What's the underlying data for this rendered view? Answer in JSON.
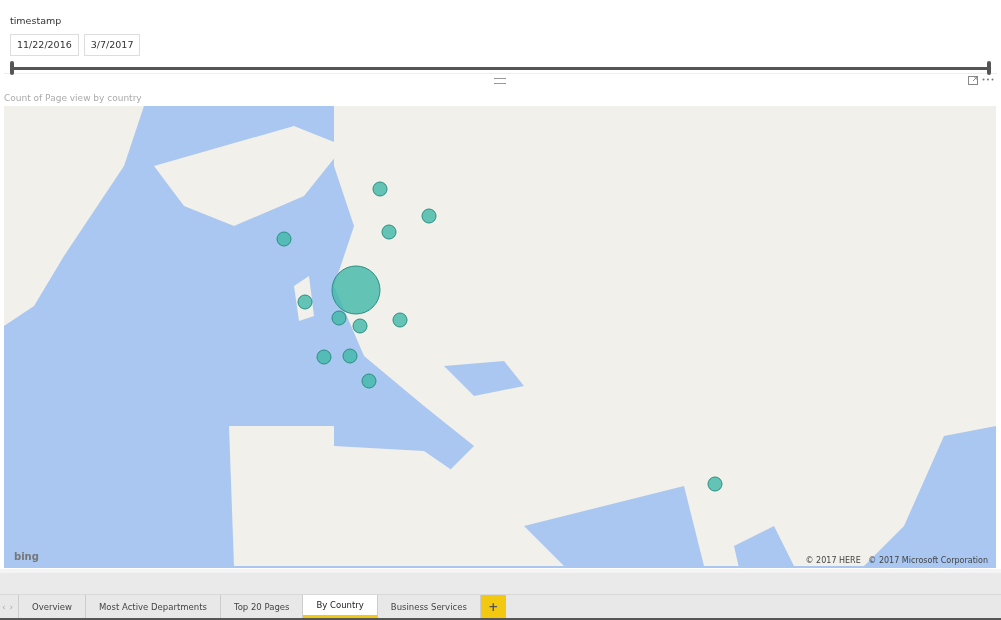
{
  "slicer": {
    "title": "timestamp",
    "start_date": "11/22/2016",
    "end_date": "3/7/2017",
    "handles": [
      {
        "level": 0
      },
      {
        "level": 1
      }
    ]
  },
  "visual": {
    "title": "Count of Page view by country",
    "logo": "bing",
    "attribution": "© 2017 HERE   © 2017 Microsoft Corporation"
  },
  "page_nav": {
    "previous": "‹",
    "next": "›"
  },
  "tabs": [
    {
      "label": "Overview",
      "selected": false
    },
    {
      "label": "Most Active Departments",
      "selected": false
    },
    {
      "label": "Top 20 Pages",
      "selected": false
    },
    {
      "label": "By Country",
      "selected": true
    },
    {
      "label": "Business Services",
      "selected": false
    }
  ],
  "add_tab": "+"
}
